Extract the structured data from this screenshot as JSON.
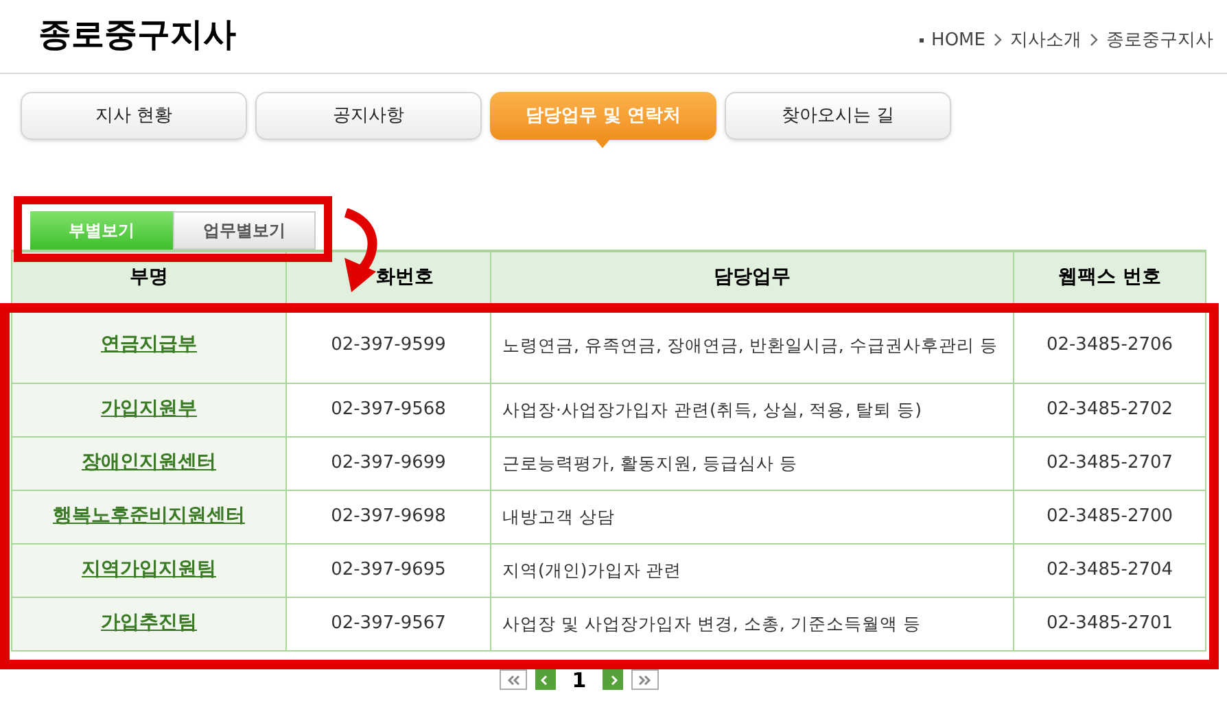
{
  "title": "종로중구지사",
  "breadcrumb": [
    "HOME",
    "지사소개",
    "종로중구지사"
  ],
  "tabs": [
    {
      "label": "지사 현황",
      "selected": false
    },
    {
      "label": "공지사항",
      "selected": false
    },
    {
      "label": "담당업무 및 연락처",
      "selected": true
    },
    {
      "label": "찾아오시는 길",
      "selected": false
    }
  ],
  "view_toggle": [
    {
      "label": "부별보기",
      "selected": true
    },
    {
      "label": "업무별보기",
      "selected": false
    }
  ],
  "table": {
    "columns": [
      "부명",
      "화번호",
      "담당업무",
      "웹팩스 번호"
    ],
    "rows": [
      {
        "department": "연금지급부",
        "phone": "02-397-9599",
        "duties": "노령연금, 유족연금, 장애연금, 반환일시금, 수급권사후관리 등",
        "fax": "02-3485-2706"
      },
      {
        "department": "가입지원부",
        "phone": "02-397-9568",
        "duties": "사업장·사업장가입자 관련(취득, 상실, 적용, 탈퇴 등)",
        "fax": "02-3485-2702"
      },
      {
        "department": "장애인지원센터",
        "phone": "02-397-9699",
        "duties": "근로능력평가, 활동지원, 등급심사 등",
        "fax": "02-3485-2707"
      },
      {
        "department": "행복노후준비지원센터",
        "phone": "02-397-9698",
        "duties": "내방고객 상담",
        "fax": "02-3485-2700"
      },
      {
        "department": "지역가입지원팀",
        "phone": "02-397-9695",
        "duties": "지역(개인)가입자 관련",
        "fax": "02-3485-2704"
      },
      {
        "department": "가입추진팀",
        "phone": "02-397-9567",
        "duties": "사업장 및 사업장가입자 변경, 소총, 기준소득월액 등",
        "fax": "02-3485-2701"
      }
    ]
  },
  "pagination": {
    "pages": [
      {
        "label": "1",
        "selected": true
      }
    ]
  }
}
